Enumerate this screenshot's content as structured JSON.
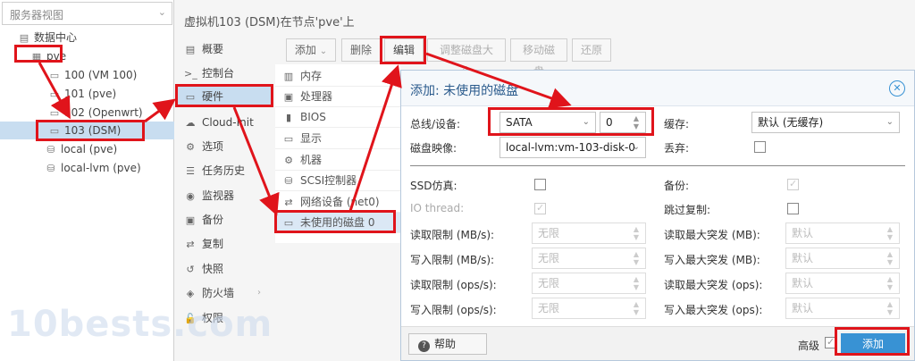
{
  "tree": {
    "view_select": "服务器视图",
    "nodes": [
      {
        "label": "数据中心",
        "icon": "datacenter-icon"
      },
      {
        "label": "pve",
        "icon": "server-icon"
      },
      {
        "label": "100 (VM 100)",
        "icon": "vm-icon"
      },
      {
        "label": "101 (pve)",
        "icon": "vm-icon"
      },
      {
        "label": "102 (Openwrt)",
        "icon": "vm-icon"
      },
      {
        "label": "103 (DSM)",
        "icon": "vm-icon"
      },
      {
        "label": "local (pve)",
        "icon": "storage-icon"
      },
      {
        "label": "local-lvm (pve)",
        "icon": "storage-icon"
      }
    ]
  },
  "vm_title": "虚拟机103 (DSM)在节点'pve'上",
  "menu": [
    {
      "label": "概要",
      "icon": "summary-icon"
    },
    {
      "label": "控制台",
      "icon": "console-icon"
    },
    {
      "label": "硬件",
      "icon": "monitor-icon"
    },
    {
      "label": "Cloud-Init",
      "icon": "cloud-icon"
    },
    {
      "label": "选项",
      "icon": "gear-icon"
    },
    {
      "label": "任务历史",
      "icon": "list-icon"
    },
    {
      "label": "监视器",
      "icon": "eye-icon"
    },
    {
      "label": "备份",
      "icon": "floppy-icon"
    },
    {
      "label": "复制",
      "icon": "retweet-icon"
    },
    {
      "label": "快照",
      "icon": "history-icon"
    },
    {
      "label": "防火墙",
      "icon": "shield-icon"
    },
    {
      "label": "权限",
      "icon": "unlock-icon"
    }
  ],
  "toolbar": {
    "add": "添加",
    "remove": "删除",
    "edit": "编辑",
    "resize": "调整磁盘大小",
    "move": "移动磁盘",
    "revert": "还原"
  },
  "hardware": [
    {
      "label": "内存",
      "icon": "memory-icon"
    },
    {
      "label": "处理器",
      "icon": "cpu-icon"
    },
    {
      "label": "BIOS",
      "icon": "bios-icon"
    },
    {
      "label": "显示",
      "icon": "display-icon"
    },
    {
      "label": "机器",
      "icon": "cogs-icon"
    },
    {
      "label": "SCSI控制器",
      "icon": "database-icon"
    },
    {
      "label": "网络设备 (net0)",
      "icon": "exchange-icon"
    },
    {
      "label": "未使用的磁盘 0",
      "icon": "hdd-icon"
    }
  ],
  "dialog": {
    "title": "添加: 未使用的磁盘",
    "bus_label": "总线/设备:",
    "bus_value": "SATA",
    "device_value": "0",
    "image_label": "磁盘映像:",
    "image_value": "local-lvm:vm-103-disk-0",
    "cache_label": "缓存:",
    "cache_value": "默认 (无缓存)",
    "discard_label": "丢弃:",
    "ssd_label": "SSD仿真:",
    "iothread_label": "IO thread:",
    "backup_label": "备份:",
    "skip_repl_label": "跳过复制:",
    "read_limit_mb": "读取限制 (MB/s):",
    "write_limit_mb": "写入限制 (MB/s):",
    "read_limit_ops": "读取限制 (ops/s):",
    "write_limit_ops": "写入限制 (ops/s):",
    "read_burst_mb": "读取最大突发 (MB):",
    "write_burst_mb": "写入最大突发 (MB):",
    "read_burst_ops": "读取最大突发 (ops):",
    "write_burst_ops": "写入最大突发 (ops):",
    "unlimited": "无限",
    "default": "默认",
    "help": "帮助",
    "advanced": "高级",
    "add": "添加"
  },
  "watermark": "10bests.com",
  "colors": {
    "accent": "#3892d4",
    "annotation": "#e0141b",
    "selection": "#c8ddf0"
  }
}
